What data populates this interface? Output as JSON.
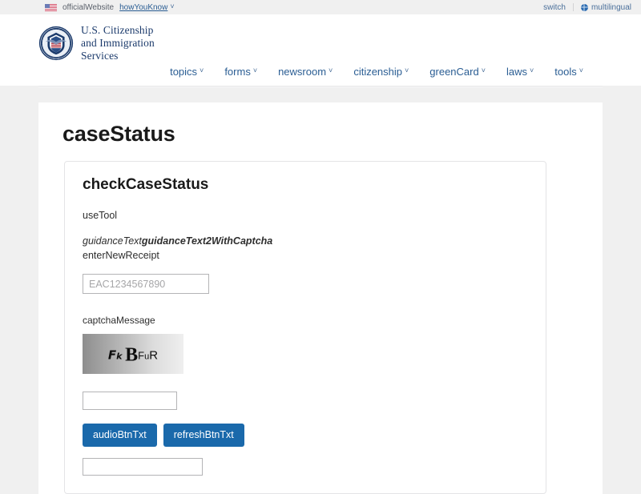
{
  "banner": {
    "flag_icon": "us-flag-icon",
    "official_text": "officialWebsite",
    "how_you_know_link": "howYouKnow",
    "chevron": "˅",
    "switch_label": "switch",
    "globe_icon": "globe-icon",
    "multilingual_label": "multilingual"
  },
  "header": {
    "seal_icon": "uscis-seal-icon",
    "brand_line1": "U.S. Citizenship",
    "brand_line2": "and Immigration",
    "brand_line3": "Services",
    "nav": [
      {
        "label": "topics",
        "chevron": "˅"
      },
      {
        "label": "forms",
        "chevron": "˅"
      },
      {
        "label": "newsroom",
        "chevron": "˅"
      },
      {
        "label": "citizenship",
        "chevron": "˅"
      },
      {
        "label": "greenCard",
        "chevron": "˅"
      },
      {
        "label": "laws",
        "chevron": "˅"
      },
      {
        "label": "tools",
        "chevron": "˅"
      }
    ]
  },
  "page": {
    "title": "caseStatus",
    "card": {
      "title": "checkCaseStatus",
      "use_tool": "useTool",
      "guidance_text": "guidanceText",
      "guidance_text2": "guidanceText2WithCaptcha",
      "enter_new_receipt": "enterNewReceipt",
      "receipt_value": "",
      "receipt_placeholder": "EAC1234567890",
      "captcha_message": "captchaMessage",
      "captcha_chars": [
        "F",
        "k",
        "B",
        "F",
        "u",
        "R"
      ],
      "captcha_answer_value": "",
      "captcha_answer_placeholder": "",
      "audio_button": "audioBtnTxt",
      "refresh_button": "refreshBtnTxt"
    }
  },
  "colors": {
    "link_blue": "#2a5d93",
    "button_blue": "#1a69ab",
    "brand_navy": "#1b3a6b",
    "page_bg": "#f0f0f0"
  }
}
